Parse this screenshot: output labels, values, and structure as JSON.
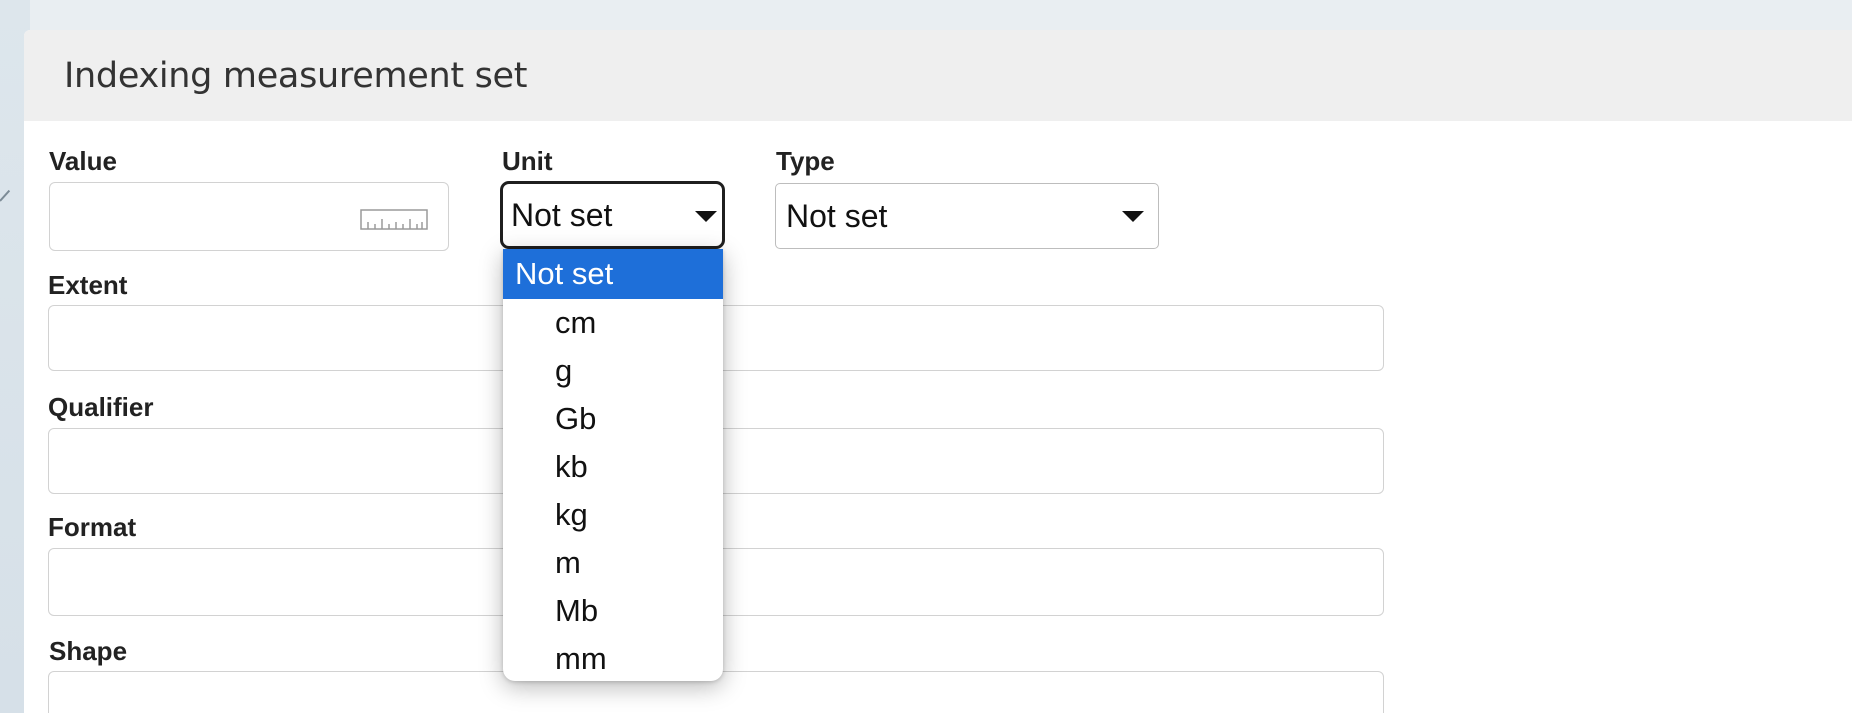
{
  "panel": {
    "title": "Indexing measurement set"
  },
  "fields": {
    "value_label": "Value",
    "unit_label": "Unit",
    "type_label": "Type",
    "extent_label": "Extent",
    "qualifier_label": "Qualifier",
    "format_label": "Format",
    "shape_label": "Shape"
  },
  "unit_select": {
    "selected": "Not set",
    "options": [
      "Not set",
      "cm",
      "g",
      "Gb",
      "kb",
      "kg",
      "m",
      "Mb",
      "mm"
    ]
  },
  "type_select": {
    "selected": "Not set"
  },
  "colors": {
    "selected_option_bg": "#1e6fd9",
    "header_bg": "#efefef"
  },
  "icons": {
    "value_field_icon": "ruler-icon",
    "select_arrow": "caret-down-icon"
  }
}
